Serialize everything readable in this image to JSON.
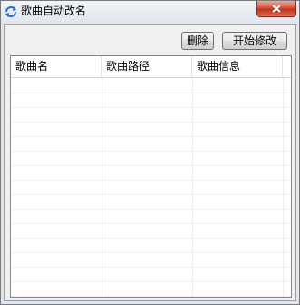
{
  "window": {
    "title": "歌曲自动改名",
    "icon": "refresh-arrows-icon",
    "close_icon": "close-icon"
  },
  "toolbar": {
    "delete_label": "删除",
    "start_label": "开始修改"
  },
  "table": {
    "columns": [
      "歌曲名",
      "歌曲路径",
      "歌曲信息"
    ],
    "rows": []
  },
  "colors": {
    "close_button": "#c0311c",
    "titlebar": "#e3e8ef",
    "client_bg": "#f0f0f0"
  }
}
